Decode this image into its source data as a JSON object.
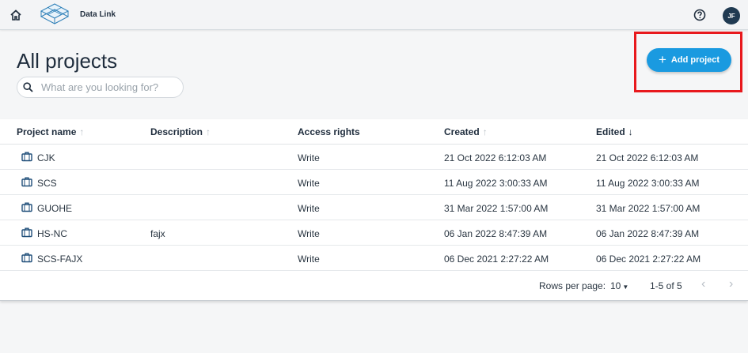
{
  "header": {
    "app_title": "Data Link",
    "avatar_initials": "JF",
    "home_icon": "home-icon",
    "help_icon": "help-icon"
  },
  "page": {
    "title": "All projects",
    "add_button_label": "Add project"
  },
  "search": {
    "placeholder": "What are you looking for?",
    "value": ""
  },
  "table": {
    "columns": [
      "Project name",
      "Description",
      "Access rights",
      "Created",
      "Edited"
    ],
    "rows": [
      {
        "name": "CJK",
        "description": "",
        "access": "Write",
        "created": "21 Oct 2022 6:12:03 AM",
        "edited": "21 Oct 2022 6:12:03 AM"
      },
      {
        "name": "SCS",
        "description": "",
        "access": "Write",
        "created": "11 Aug 2022 3:00:33 AM",
        "edited": "11 Aug 2022 3:00:33 AM"
      },
      {
        "name": "GUOHE",
        "description": "",
        "access": "Write",
        "created": "31 Mar 2022 1:57:00 AM",
        "edited": "31 Mar 2022 1:57:00 AM"
      },
      {
        "name": "HS-NC",
        "description": "fajx",
        "access": "Write",
        "created": "06 Jan 2022 8:47:39 AM",
        "edited": "06 Jan 2022 8:47:39 AM"
      },
      {
        "name": "SCS-FAJX",
        "description": "",
        "access": "Write",
        "created": "06 Dec 2021 2:27:22 AM",
        "edited": "06 Dec 2021 2:27:22 AM"
      }
    ]
  },
  "pagination": {
    "rows_per_page_label": "Rows per page:",
    "rows_per_page_value": "10",
    "range": "1-5 of 5"
  },
  "colors": {
    "accent": "#1a9ae0",
    "highlight": "#e8191d",
    "avatar": "#203a52"
  }
}
